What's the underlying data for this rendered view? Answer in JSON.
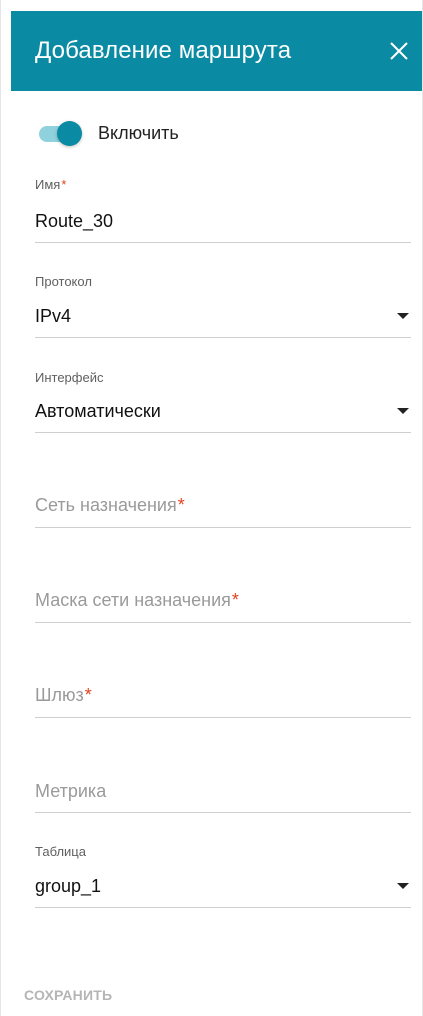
{
  "header": {
    "title": "Добавление маршрута",
    "close_icon": "close-icon"
  },
  "enable": {
    "label": "Включить",
    "checked": true,
    "accent_color": "#0a8aa3"
  },
  "fields": {
    "name": {
      "label": "Имя",
      "required_mark": "*",
      "value": "Route_30"
    },
    "protocol": {
      "label": "Протокол",
      "value": "IPv4"
    },
    "interface": {
      "label": "Интерфейс",
      "value": "Автоматически"
    },
    "destination": {
      "placeholder": "Сеть назначения",
      "required_mark": "*",
      "value": ""
    },
    "mask": {
      "placeholder": "Маска сети назначения",
      "required_mark": "*",
      "value": ""
    },
    "gateway": {
      "placeholder": "Шлюз",
      "required_mark": "*",
      "value": ""
    },
    "metric": {
      "placeholder": "Метрика",
      "value": ""
    },
    "table": {
      "label": "Таблица",
      "value": "group_1"
    }
  },
  "actions": {
    "save_label": "СОХРАНИТЬ"
  },
  "colors": {
    "header_bg": "#0a8aa3",
    "required": "#e2411f",
    "disabled_text": "#b5b5b5"
  }
}
